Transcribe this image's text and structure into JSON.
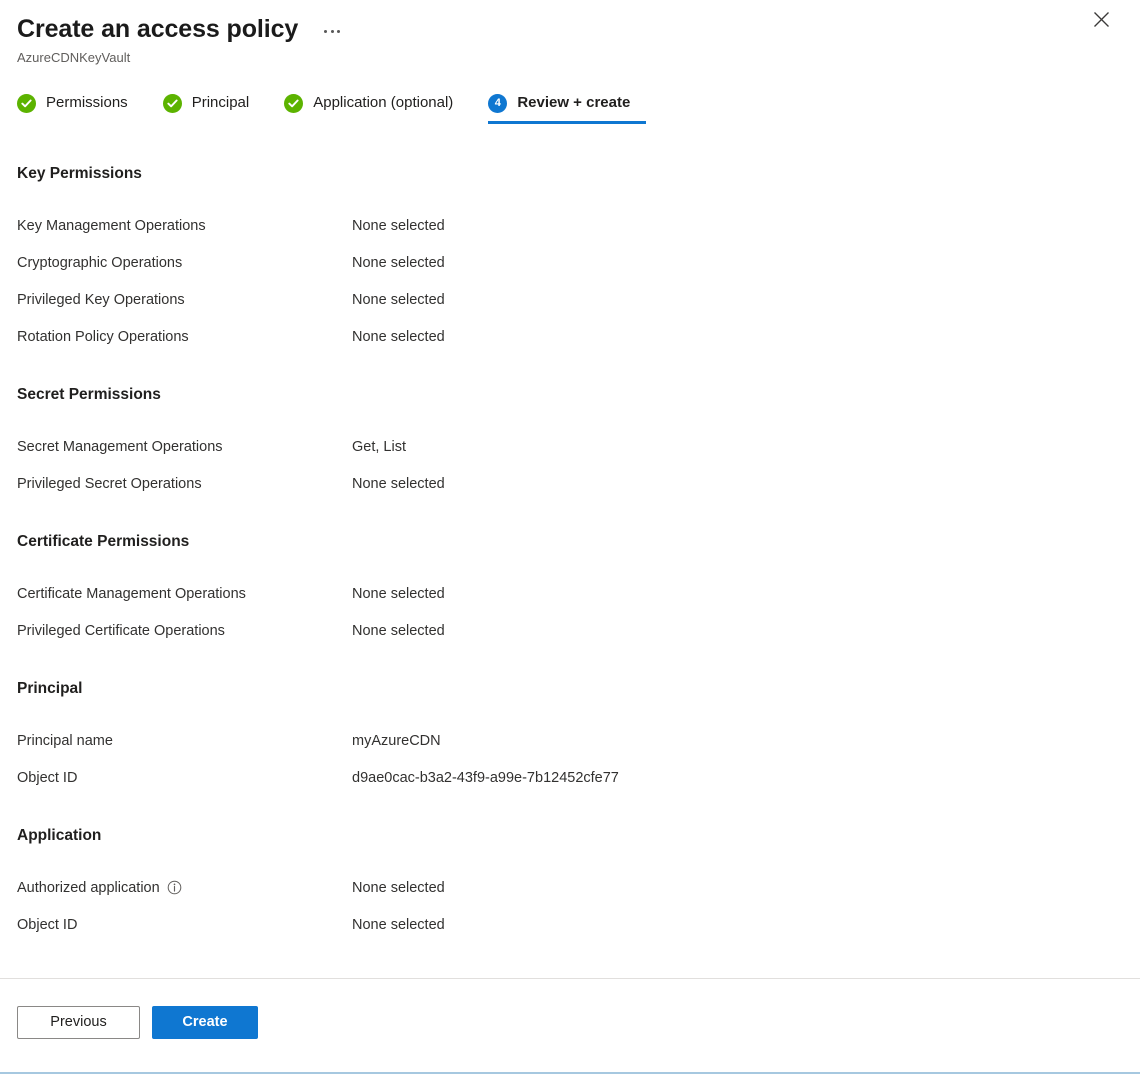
{
  "header": {
    "title": "Create an access policy",
    "subtitle": "AzureCDNKeyVault",
    "more_menu_label": "...",
    "close_label": "Close"
  },
  "tabs": [
    {
      "label": "Permissions",
      "state": "done",
      "badge": ""
    },
    {
      "label": "Principal",
      "state": "done",
      "badge": ""
    },
    {
      "label": "Application (optional)",
      "state": "done",
      "badge": ""
    },
    {
      "label": "Review + create",
      "state": "current",
      "badge": "4"
    }
  ],
  "sections": [
    {
      "title": "Key Permissions",
      "rows": [
        {
          "label": "Key Management Operations",
          "value": "None selected",
          "info": false
        },
        {
          "label": "Cryptographic Operations",
          "value": "None selected",
          "info": false
        },
        {
          "label": "Privileged Key Operations",
          "value": "None selected",
          "info": false
        },
        {
          "label": "Rotation Policy Operations",
          "value": "None selected",
          "info": false
        }
      ]
    },
    {
      "title": "Secret Permissions",
      "rows": [
        {
          "label": "Secret Management Operations",
          "value": "Get, List",
          "info": false
        },
        {
          "label": "Privileged Secret Operations",
          "value": "None selected",
          "info": false
        }
      ]
    },
    {
      "title": "Certificate Permissions",
      "rows": [
        {
          "label": "Certificate Management Operations",
          "value": "None selected",
          "info": false
        },
        {
          "label": "Privileged Certificate Operations",
          "value": "None selected",
          "info": false
        }
      ]
    },
    {
      "title": "Principal",
      "rows": [
        {
          "label": "Principal name",
          "value": "myAzureCDN",
          "info": false
        },
        {
          "label": "Object ID",
          "value": "d9ae0cac-b3a2-43f9-a99e-7b12452cfe77",
          "info": false
        }
      ]
    },
    {
      "title": "Application",
      "rows": [
        {
          "label": "Authorized application",
          "value": "None selected",
          "info": true
        },
        {
          "label": "Object ID",
          "value": "None selected",
          "info": false
        }
      ]
    }
  ],
  "footer": {
    "previous_label": "Previous",
    "create_label": "Create"
  },
  "colors": {
    "accent": "#0f77d1",
    "success": "#5cb300",
    "text": "#323130",
    "muted": "#605e5c"
  }
}
